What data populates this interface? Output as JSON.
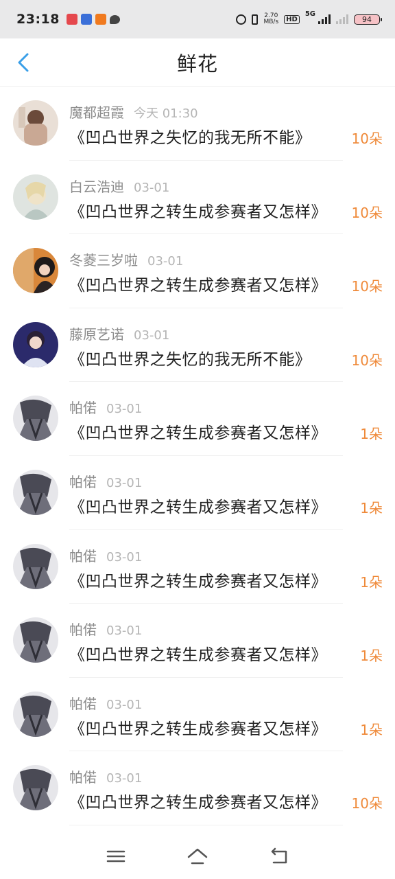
{
  "status_bar": {
    "time": "23:18",
    "net_speed_value": "2.70",
    "net_speed_unit": "MB/s",
    "hd_label": "HD",
    "network_type": "5G",
    "battery": "94"
  },
  "header": {
    "title": "鲜花"
  },
  "items": [
    {
      "username": "魔都超霞",
      "date": "今天 01:30",
      "book": "《凹凸世界之失忆的我无所不能》",
      "amount": "10朵"
    },
    {
      "username": "白云浩迪",
      "date": "03-01",
      "book": "《凹凸世界之转生成参赛者又怎样》",
      "amount": "10朵"
    },
    {
      "username": "冬菱三岁啦",
      "date": "03-01",
      "book": "《凹凸世界之转生成参赛者又怎样》",
      "amount": "10朵"
    },
    {
      "username": "藤原艺诺",
      "date": "03-01",
      "book": "《凹凸世界之失忆的我无所不能》",
      "amount": "10朵"
    },
    {
      "username": "帕偌",
      "date": "03-01",
      "book": "《凹凸世界之转生成参赛者又怎样》",
      "amount": "1朵"
    },
    {
      "username": "帕偌",
      "date": "03-01",
      "book": "《凹凸世界之转生成参赛者又怎样》",
      "amount": "1朵"
    },
    {
      "username": "帕偌",
      "date": "03-01",
      "book": "《凹凸世界之转生成参赛者又怎样》",
      "amount": "1朵"
    },
    {
      "username": "帕偌",
      "date": "03-01",
      "book": "《凹凸世界之转生成参赛者又怎样》",
      "amount": "1朵"
    },
    {
      "username": "帕偌",
      "date": "03-01",
      "book": "《凹凸世界之转生成参赛者又怎样》",
      "amount": "1朵"
    },
    {
      "username": "帕偌",
      "date": "03-01",
      "book": "《凹凸世界之转生成参赛者又怎样》",
      "amount": "10朵"
    }
  ],
  "icons": {
    "back": "chevron-left-icon",
    "menu": "menu-icon",
    "home": "home-icon",
    "return": "return-icon"
  },
  "colors": {
    "accent_blue": "#3a9fe8",
    "amount_orange": "#ef8a3a",
    "status_bar_bg": "#e9e9ea"
  }
}
